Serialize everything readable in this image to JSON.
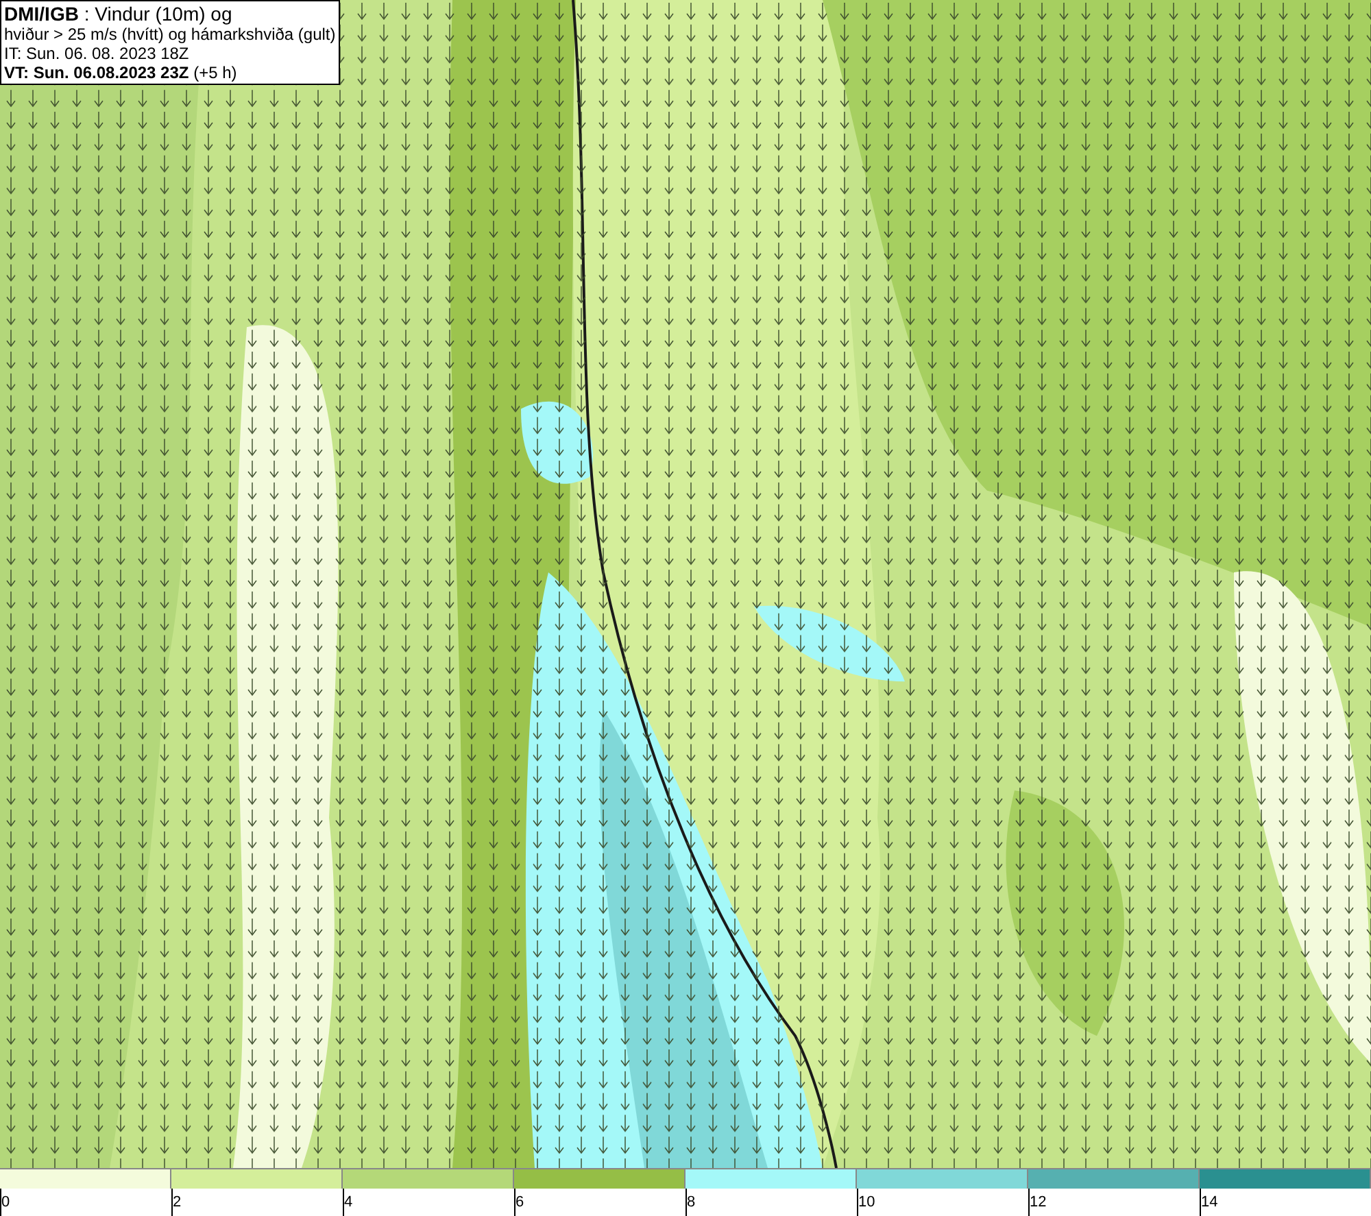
{
  "title_box": {
    "lines": [
      "**DMI/IGB** : Vindur (10m) og",
      "hviður > 25 m/s (hvítt) og hámarkshviða (gult)",
      "IT: Sun. 06. 08. 2023 18Z",
      "**VT: Sun. 06.08.2023 23Z** (+5 h)"
    ]
  },
  "legend": {
    "bins": [
      {
        "color": "#f4fbdc"
      },
      {
        "color": "#d4ee9a"
      },
      {
        "color": "#b4d878"
      },
      {
        "color": "#95be46"
      },
      {
        "color": "#a4f8f8"
      },
      {
        "color": "#80d8d8"
      },
      {
        "color": "#56b0b0"
      },
      {
        "color": "#2a9090"
      }
    ],
    "ticks": [
      "0",
      "2",
      "4",
      "6",
      "8",
      "10",
      "12",
      "14"
    ]
  }
}
